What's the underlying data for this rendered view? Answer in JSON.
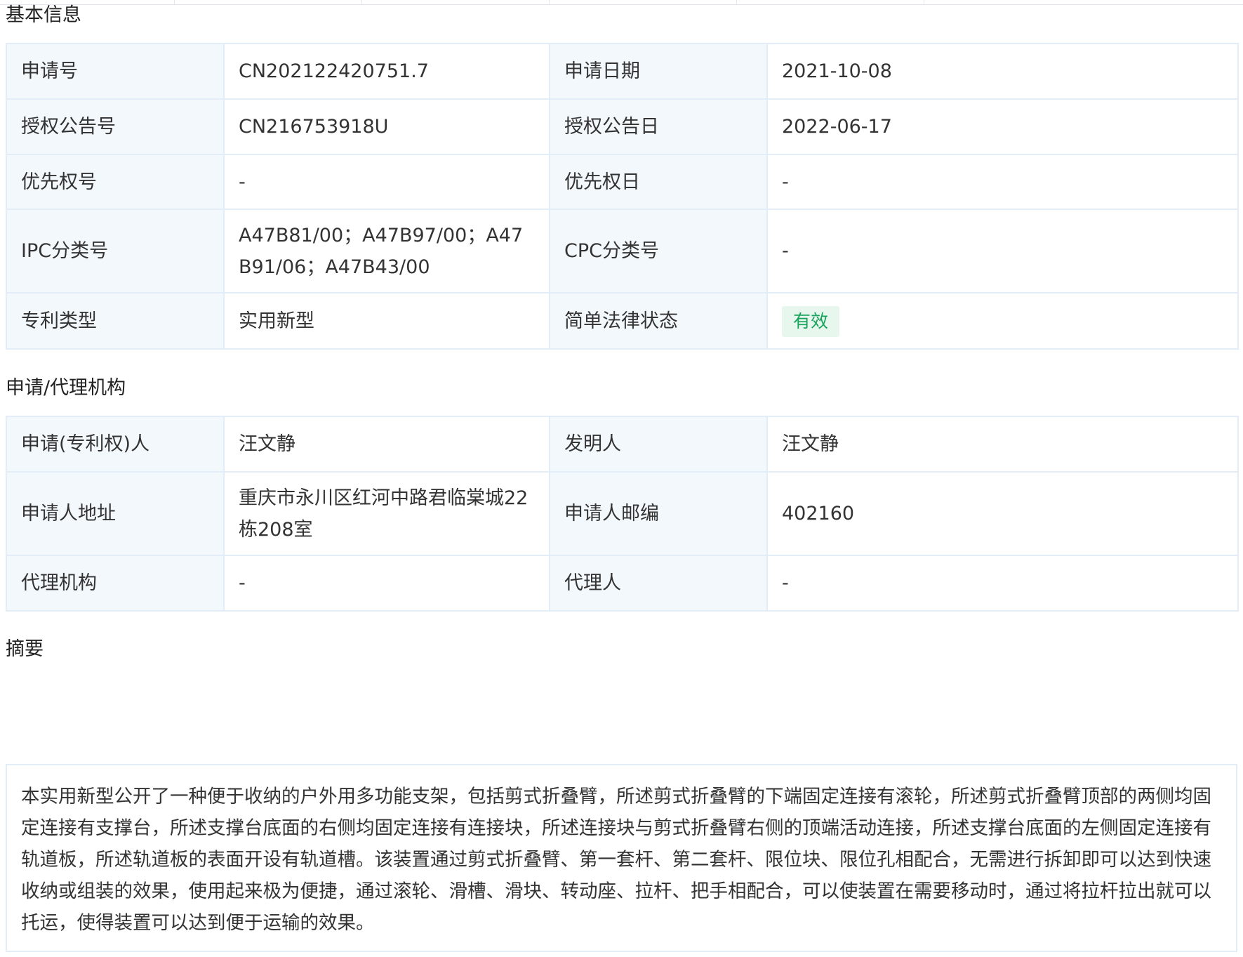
{
  "sections": {
    "basic_info": "基本信息",
    "applicant_agency": "申请/代理机构",
    "abstract": "摘要"
  },
  "basic_info": {
    "rows": [
      {
        "label1": "申请号",
        "value1": "CN202122420751.7",
        "label2": "申请日期",
        "value2": "2021-10-08"
      },
      {
        "label1": "授权公告号",
        "value1": "CN216753918U",
        "label2": "授权公告日",
        "value2": "2022-06-17"
      },
      {
        "label1": "优先权号",
        "value1": "-",
        "label2": "优先权日",
        "value2": "-"
      },
      {
        "label1": "IPC分类号",
        "value1": "A47B81/00；A47B97/00；A47B91/06；A47B43/00",
        "label2": "CPC分类号",
        "value2": "-"
      },
      {
        "label1": "专利类型",
        "value1": "实用新型",
        "label2": "简单法律状态",
        "value2": "有效"
      }
    ],
    "status_color": "#16a35a"
  },
  "applicant_agency": {
    "rows": [
      {
        "label1": "申请(专利权)人",
        "value1": "汪文静",
        "label2": "发明人",
        "value2": "汪文静"
      },
      {
        "label1": "申请人地址",
        "value1": "重庆市永川区红河中路君临棠城22栋208室",
        "label2": "申请人邮编",
        "value2": "402160"
      },
      {
        "label1": "代理机构",
        "value1": "-",
        "label2": "代理人",
        "value2": "-"
      }
    ]
  },
  "abstract": {
    "text": "本实用新型公开了一种便于收纳的户外用多功能支架，包括剪式折叠臂，所述剪式折叠臂的下端固定连接有滚轮，所述剪式折叠臂顶部的两侧均固定连接有支撑台，所述支撑台底面的右侧均固定连接有连接块，所述连接块与剪式折叠臂右侧的顶端活动连接，所述支撑台底面的左侧固定连接有轨道板，所述轨道板的表面开设有轨道槽。该装置通过剪式折叠臂、第一套杆、第二套杆、限位块、限位孔相配合，无需进行拆卸即可以达到快速收纳或组装的效果，使用起来极为便捷，通过滚轮、滑槽、滑块、转动座、拉杆、把手相配合，可以使装置在需要移动时，通过将拉杆拉出就可以托运，使得装置可以达到便于运输的效果。"
  }
}
